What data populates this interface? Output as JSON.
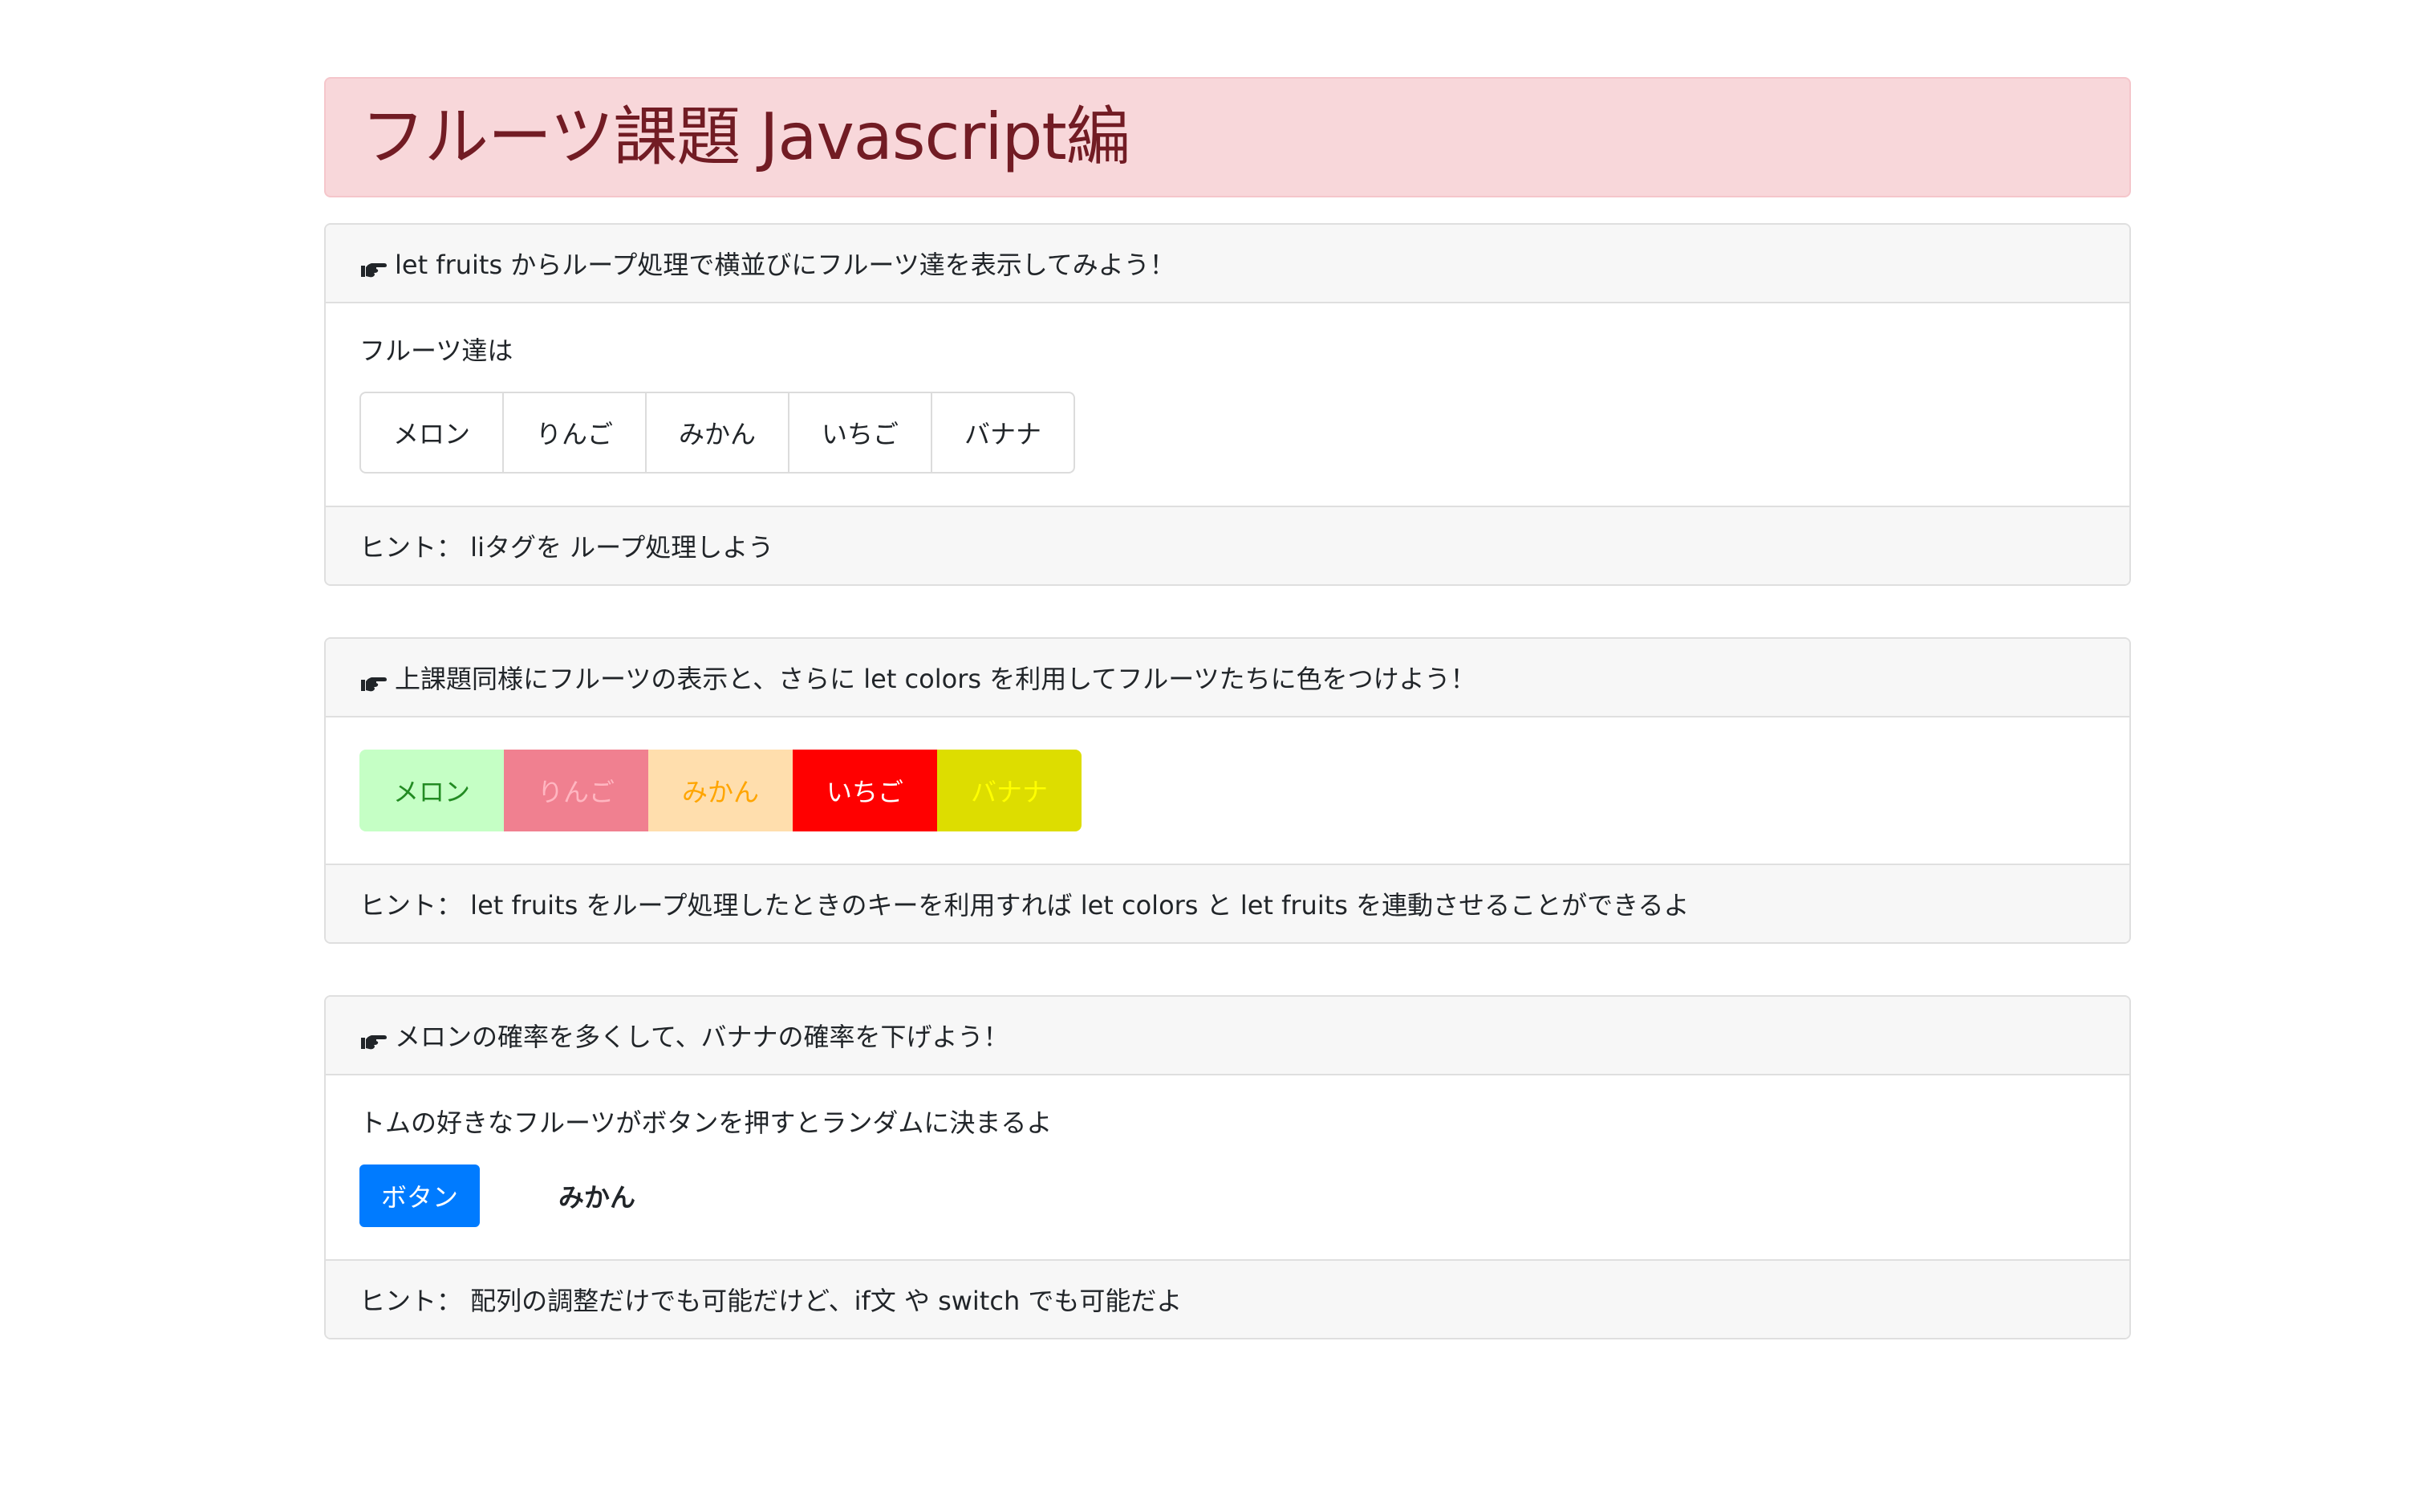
{
  "header": {
    "title": "フルーツ課題 Javascript編"
  },
  "card1": {
    "heading": "let fruits からループ処理で横並びにフルーツ達を表示してみよう！",
    "intro": "フルーツ達は",
    "fruits": [
      "メロン",
      "りんご",
      "みかん",
      "いちご",
      "バナナ"
    ],
    "hint": "ヒント： liタグを ループ処理しよう"
  },
  "card2": {
    "heading": "上課題同様にフルーツの表示と、さらに let colors を利用してフルーツたちに色をつけよう！",
    "fruits": [
      "メロン",
      "りんご",
      "みかん",
      "いちご",
      "バナナ"
    ],
    "colors": [
      {
        "bg": "#c5ffc5",
        "fg": "#228b22"
      },
      {
        "bg": "#f08090",
        "fg": "#ffb6c1"
      },
      {
        "bg": "#ffdead",
        "fg": "#ffa500"
      },
      {
        "bg": "#ff0000",
        "fg": "#ffffff"
      },
      {
        "bg": "#dddd00",
        "fg": "#ffff00"
      }
    ],
    "hint": "ヒント： let fruits をループ処理したときのキーを利用すれば let colors と let fruits を連動させることができるよ"
  },
  "card3": {
    "heading": "メロンの確率を多くして、バナナの確率を下げよう！",
    "intro": "トムの好きなフルーツがボタンを押すとランダムに決まるよ",
    "button_label": "ボタン",
    "result": "みかん",
    "hint": "ヒント： 配列の調整だけでも可能だけど、if文 や switch でも可能だよ"
  },
  "icons": {
    "card_header_icon": "pointing-hand-icon"
  }
}
